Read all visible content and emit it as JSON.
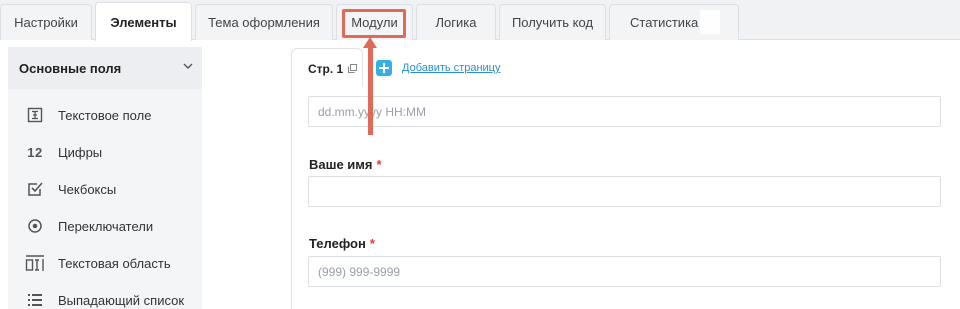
{
  "tabs": [
    {
      "label": "Настройки"
    },
    {
      "label": "Элементы"
    },
    {
      "label": "Тема оформления"
    },
    {
      "label": "Модули"
    },
    {
      "label": "Логика"
    },
    {
      "label": "Получить код"
    },
    {
      "label": "Статистика"
    }
  ],
  "active_tab": "Элементы",
  "highlighted_tab": "Модули",
  "sidebar": {
    "section_title": "Основные поля",
    "items": [
      {
        "label": "Текстовое поле",
        "icon": "text-field-icon"
      },
      {
        "label": "Цифры",
        "icon": "digits-icon",
        "glyph": "12"
      },
      {
        "label": "Чекбоксы",
        "icon": "checkbox-icon"
      },
      {
        "label": "Переключатели",
        "icon": "radio-icon"
      },
      {
        "label": "Текстовая область",
        "icon": "textarea-icon"
      },
      {
        "label": "Выпадающий список",
        "icon": "dropdown-list-icon"
      }
    ]
  },
  "page": {
    "tab_label": "Стр. 1",
    "add_page_label": "Добавить страницу"
  },
  "form": {
    "datetime_placeholder": "dd.mm.yyyy HH:MM",
    "name_label": "Ваше имя",
    "phone_label": "Телефон",
    "phone_placeholder": "(999) 999-9999",
    "required_mark": "*"
  },
  "colors": {
    "accent": "#36aee6",
    "link": "#2a8fd6",
    "annotation": "#e06a5a",
    "required": "#e53935"
  }
}
